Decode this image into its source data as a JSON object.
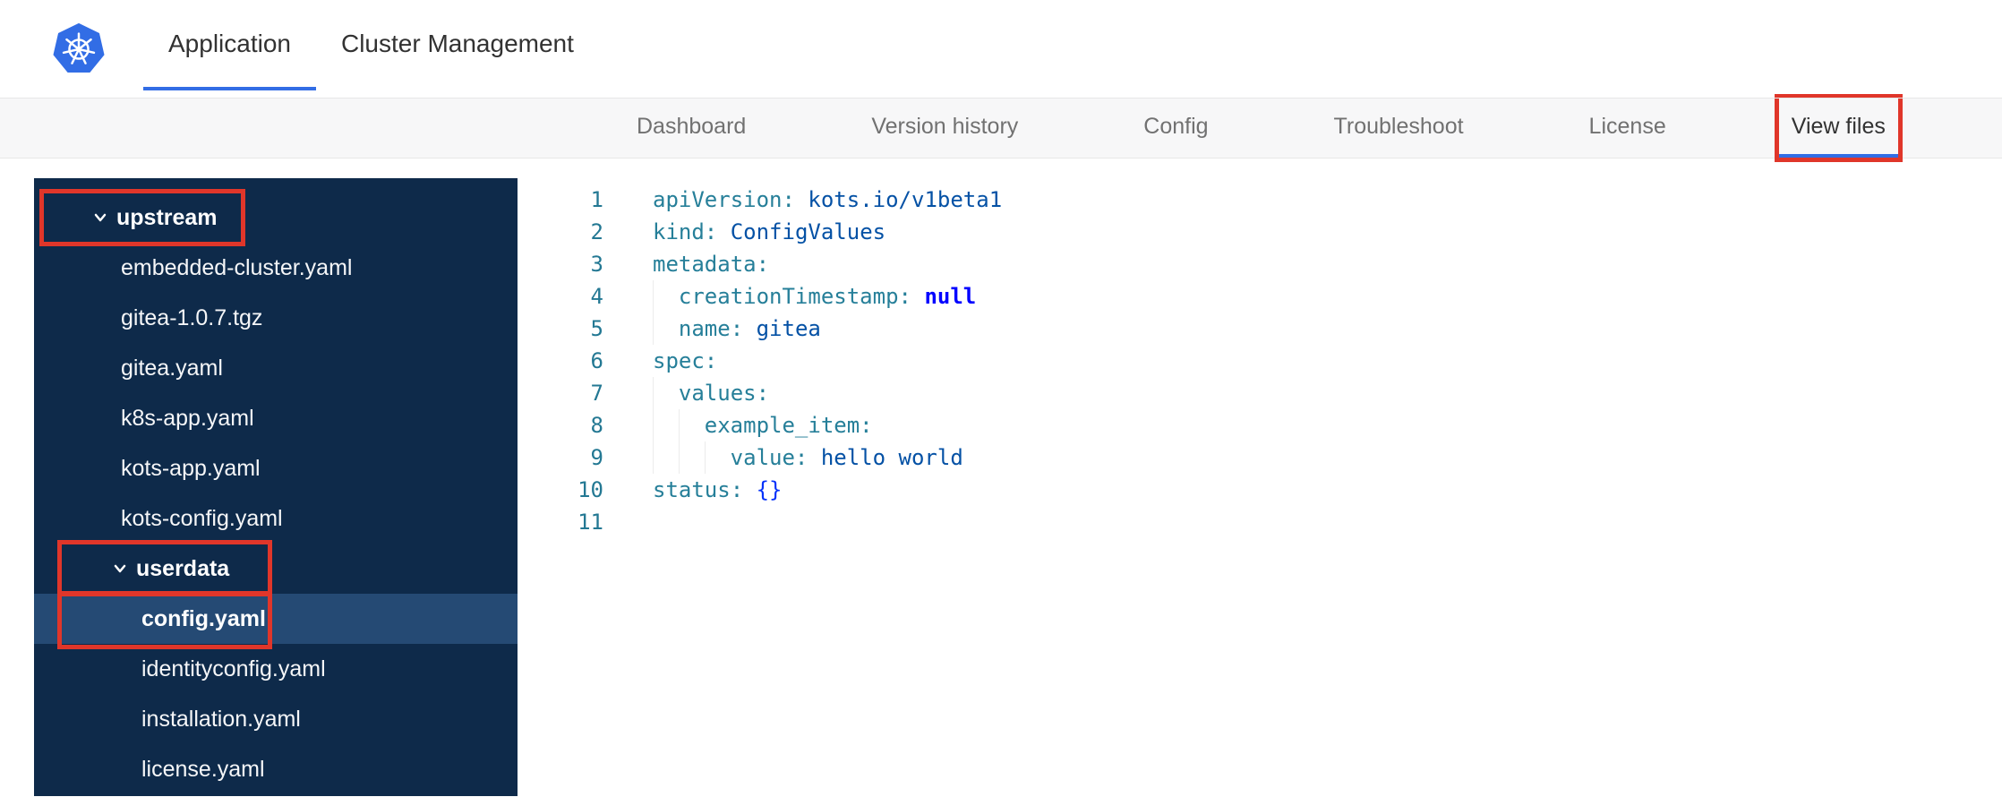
{
  "colors": {
    "accent_blue": "#326de5",
    "annotation_red": "#e0362a",
    "sidebar_bg": "#0e2a4a",
    "sidebar_selected_bg": "#254a74",
    "subnav_bg": "#f7f7f8",
    "text_dark": "#323232",
    "text_gray": "#717171",
    "code_key": "#267f99",
    "code_value": "#0451a5",
    "code_keyword": "#0000ff",
    "code_bracket": "#0431fa",
    "line_number": "#237893"
  },
  "header": {
    "logo_icon": "kubernetes-helm-wheel",
    "tabs": [
      {
        "label": "Application",
        "active": true
      },
      {
        "label": "Cluster Management",
        "active": false
      }
    ]
  },
  "subnav": {
    "tabs": [
      {
        "label": "Dashboard",
        "active": false,
        "annotated": false
      },
      {
        "label": "Version history",
        "active": false,
        "annotated": false
      },
      {
        "label": "Config",
        "active": false,
        "annotated": false
      },
      {
        "label": "Troubleshoot",
        "active": false,
        "annotated": false
      },
      {
        "label": "License",
        "active": false,
        "annotated": false
      },
      {
        "label": "View files",
        "active": true,
        "annotated": true
      }
    ]
  },
  "file_tree": {
    "items": [
      {
        "label": "upstream",
        "type": "folder",
        "level": 0,
        "expanded": true,
        "annotated": true,
        "selected": false
      },
      {
        "label": "embedded-cluster.yaml",
        "type": "file",
        "level": 1,
        "selected": false
      },
      {
        "label": "gitea-1.0.7.tgz",
        "type": "file",
        "level": 1,
        "selected": false
      },
      {
        "label": "gitea.yaml",
        "type": "file",
        "level": 1,
        "selected": false
      },
      {
        "label": "k8s-app.yaml",
        "type": "file",
        "level": 1,
        "selected": false
      },
      {
        "label": "kots-app.yaml",
        "type": "file",
        "level": 1,
        "selected": false
      },
      {
        "label": "kots-config.yaml",
        "type": "file",
        "level": 1,
        "selected": false
      },
      {
        "label": "userdata",
        "type": "folder",
        "level": 1,
        "expanded": true,
        "annotated": true,
        "selected": false
      },
      {
        "label": "config.yaml",
        "type": "file",
        "level": 2,
        "selected": true,
        "annotated": true
      },
      {
        "label": "identityconfig.yaml",
        "type": "file",
        "level": 2,
        "selected": false
      },
      {
        "label": "installation.yaml",
        "type": "file",
        "level": 2,
        "selected": false
      },
      {
        "label": "license.yaml",
        "type": "file",
        "level": 2,
        "selected": false
      }
    ]
  },
  "editor": {
    "language": "yaml",
    "lines": [
      {
        "n": "1",
        "indent": 0,
        "tokens": [
          [
            "key",
            "apiVersion:"
          ],
          [
            "sp",
            " "
          ],
          [
            "value",
            "kots.io/v1beta1"
          ]
        ]
      },
      {
        "n": "2",
        "indent": 0,
        "tokens": [
          [
            "key",
            "kind:"
          ],
          [
            "sp",
            " "
          ],
          [
            "value",
            "ConfigValues"
          ]
        ]
      },
      {
        "n": "3",
        "indent": 0,
        "tokens": [
          [
            "key",
            "metadata:"
          ]
        ]
      },
      {
        "n": "4",
        "indent": 1,
        "tokens": [
          [
            "key",
            "creationTimestamp:"
          ],
          [
            "sp",
            " "
          ],
          [
            "keyword",
            "null"
          ]
        ]
      },
      {
        "n": "5",
        "indent": 1,
        "tokens": [
          [
            "key",
            "name:"
          ],
          [
            "sp",
            " "
          ],
          [
            "value",
            "gitea"
          ]
        ]
      },
      {
        "n": "6",
        "indent": 0,
        "tokens": [
          [
            "key",
            "spec:"
          ]
        ]
      },
      {
        "n": "7",
        "indent": 1,
        "tokens": [
          [
            "key",
            "values:"
          ]
        ]
      },
      {
        "n": "8",
        "indent": 2,
        "tokens": [
          [
            "key",
            "example_item:"
          ]
        ]
      },
      {
        "n": "9",
        "indent": 3,
        "tokens": [
          [
            "key",
            "value:"
          ],
          [
            "sp",
            " "
          ],
          [
            "value",
            "hello world"
          ]
        ]
      },
      {
        "n": "10",
        "indent": 0,
        "tokens": [
          [
            "key",
            "status:"
          ],
          [
            "sp",
            " "
          ],
          [
            "bracket",
            "{}"
          ]
        ]
      },
      {
        "n": "11",
        "indent": 0,
        "tokens": []
      }
    ]
  }
}
